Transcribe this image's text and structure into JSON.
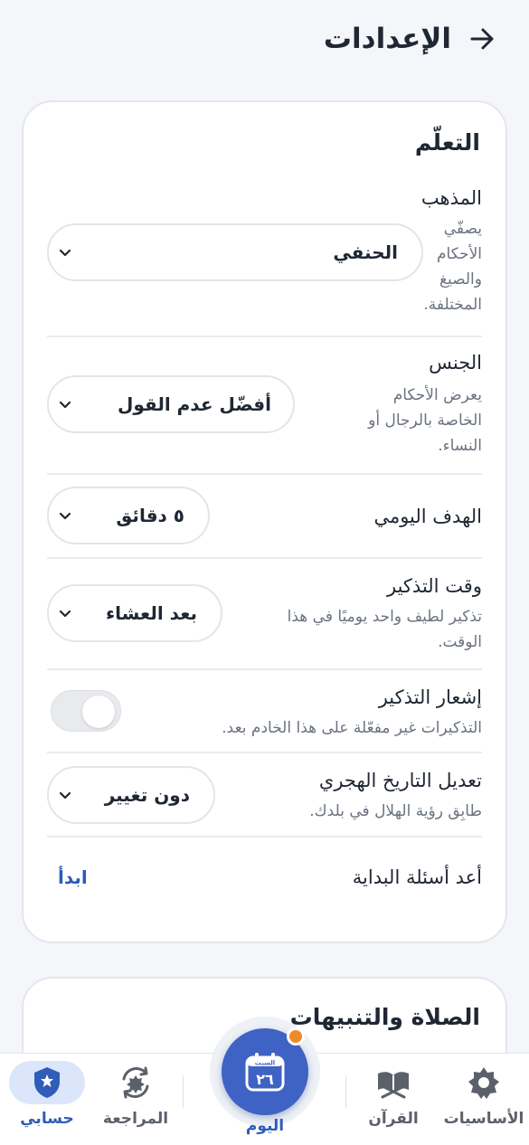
{
  "header": {
    "title": "الإعدادات",
    "back_icon": "arrow-right-icon"
  },
  "learning": {
    "title": "التعلّم",
    "madhab": {
      "label": "المذهب",
      "desc_lines": [
        "يصفّي",
        "الأحكام",
        "والصيغ",
        "المختلفة."
      ],
      "value": "الحنفي"
    },
    "gender": {
      "label": "الجنس",
      "desc_lines": [
        "يعرض الأحكام",
        "الخاصة بالرجال أو",
        "النساء."
      ],
      "value": "أفضّل عدم القول"
    },
    "daily_goal": {
      "label": "الهدف اليومي",
      "value": "٥ دقائق"
    },
    "reminder_time": {
      "label": "وقت التذكير",
      "desc_lines": [
        "تذكير لطيف واحد يوميًا في هذا",
        "الوقت."
      ],
      "value": "بعد العشاء"
    },
    "reminder_notification": {
      "label": "إشعار التذكير",
      "desc": "التذكيرات غير مفعّلة على هذا الخادم بعد.",
      "enabled": false
    },
    "hijri_adjust": {
      "label": "تعديل التاريخ الهجري",
      "desc": "طابِق رؤية الهلال في بلدك.",
      "value": "دون تغيير"
    },
    "redo_onboarding": {
      "label": "أعد أسئلة البداية",
      "action": "ابدأ"
    }
  },
  "prayer": {
    "title": "الصلاة والتنبيهات"
  },
  "bottom_nav": {
    "items": [
      {
        "label": "الأساسيات",
        "icon": "star-badge-icon"
      },
      {
        "label": "القرآن",
        "icon": "quran-icon"
      },
      {
        "label": "اليوم",
        "icon": "calendar-icon",
        "calendar_top": "السبت",
        "calendar_day": "٢٦"
      },
      {
        "label": "المراجعة",
        "icon": "review-cycle-icon"
      },
      {
        "label": "حسابي",
        "icon": "shield-icon",
        "active": true
      }
    ],
    "colors": {
      "accent": "#3f63c4",
      "active_label": "#2f5db8",
      "notify_dot": "#ef8a2a"
    }
  }
}
